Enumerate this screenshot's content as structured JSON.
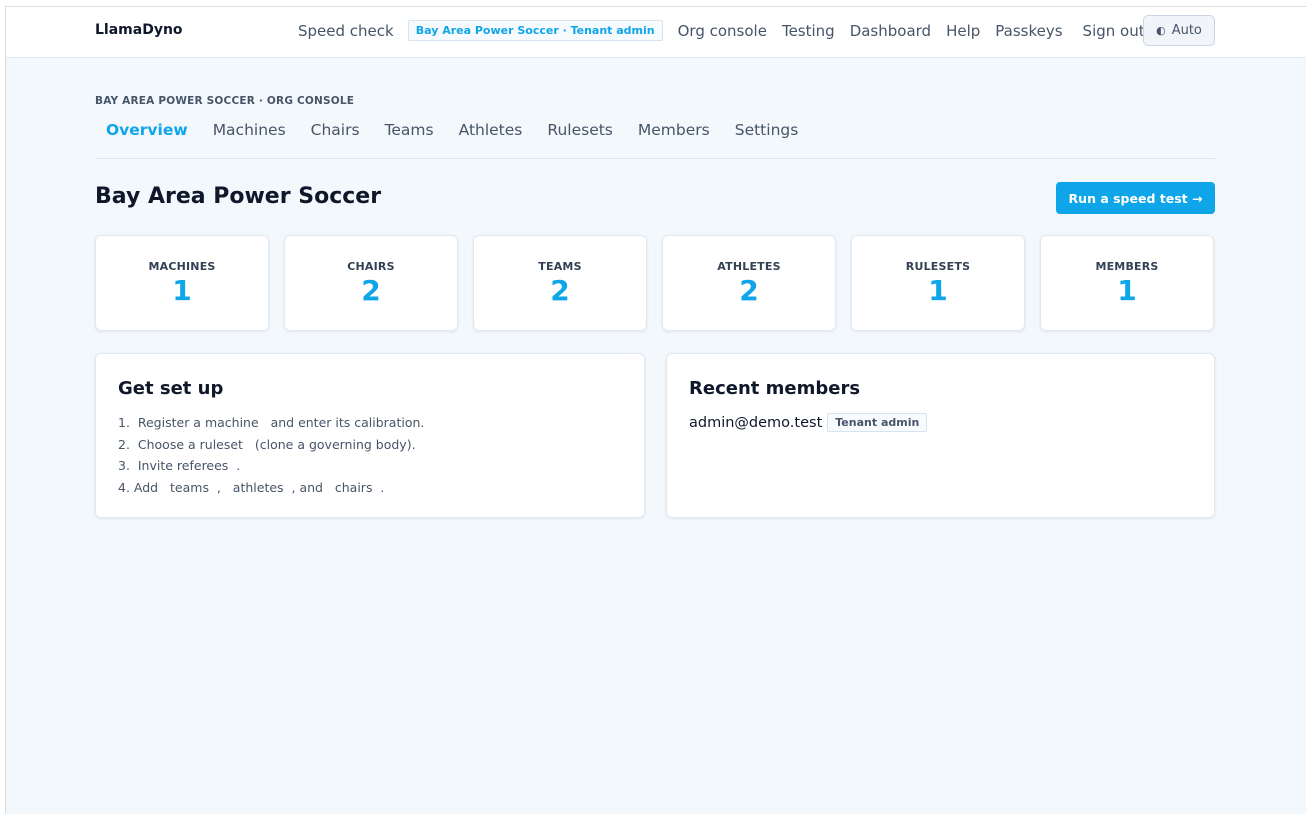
{
  "header": {
    "brand": "LlamaDyno",
    "nav": {
      "speed_check": "Speed check",
      "tenant_chip": "Bay Area Power Soccer · Tenant admin",
      "org_console": "Org console",
      "testing": "Testing",
      "dashboard": "Dashboard",
      "help": "Help",
      "passkeys": "Passkeys",
      "sign_out": "Sign out"
    },
    "theme": {
      "icon": "contrast-icon",
      "label": "Auto"
    }
  },
  "org": {
    "label": "BAY AREA POWER SOCCER · ORG CONSOLE",
    "tabs": [
      {
        "label": "Overview",
        "active": true
      },
      {
        "label": "Machines"
      },
      {
        "label": "Chairs"
      },
      {
        "label": "Teams"
      },
      {
        "label": "Athletes"
      },
      {
        "label": "Rulesets"
      },
      {
        "label": "Members"
      },
      {
        "label": "Settings"
      }
    ]
  },
  "page": {
    "title": "Bay Area Power Soccer",
    "run_button": "Run a speed test →"
  },
  "stats": [
    {
      "label": "MACHINES",
      "value": "1"
    },
    {
      "label": "CHAIRS",
      "value": "2"
    },
    {
      "label": "TEAMS",
      "value": "2"
    },
    {
      "label": "ATHLETES",
      "value": "2"
    },
    {
      "label": "RULESETS",
      "value": "1"
    },
    {
      "label": "MEMBERS",
      "value": "1"
    }
  ],
  "setup": {
    "title": "Get set up",
    "steps": [
      "1.  Register a machine   and enter its calibration.",
      "2.  Choose a ruleset   (clone a governing body).",
      "3.  Invite referees  .",
      "4. Add   teams  ,   athletes  , and   chairs  ."
    ]
  },
  "recent_members": {
    "title": "Recent members",
    "members": [
      {
        "email": "admin@demo.test",
        "role": "Tenant admin"
      }
    ]
  },
  "colors": {
    "accent": "#0ea5e9",
    "text": "#0f172a",
    "muted": "#475569",
    "background": "#f3f8fc"
  }
}
